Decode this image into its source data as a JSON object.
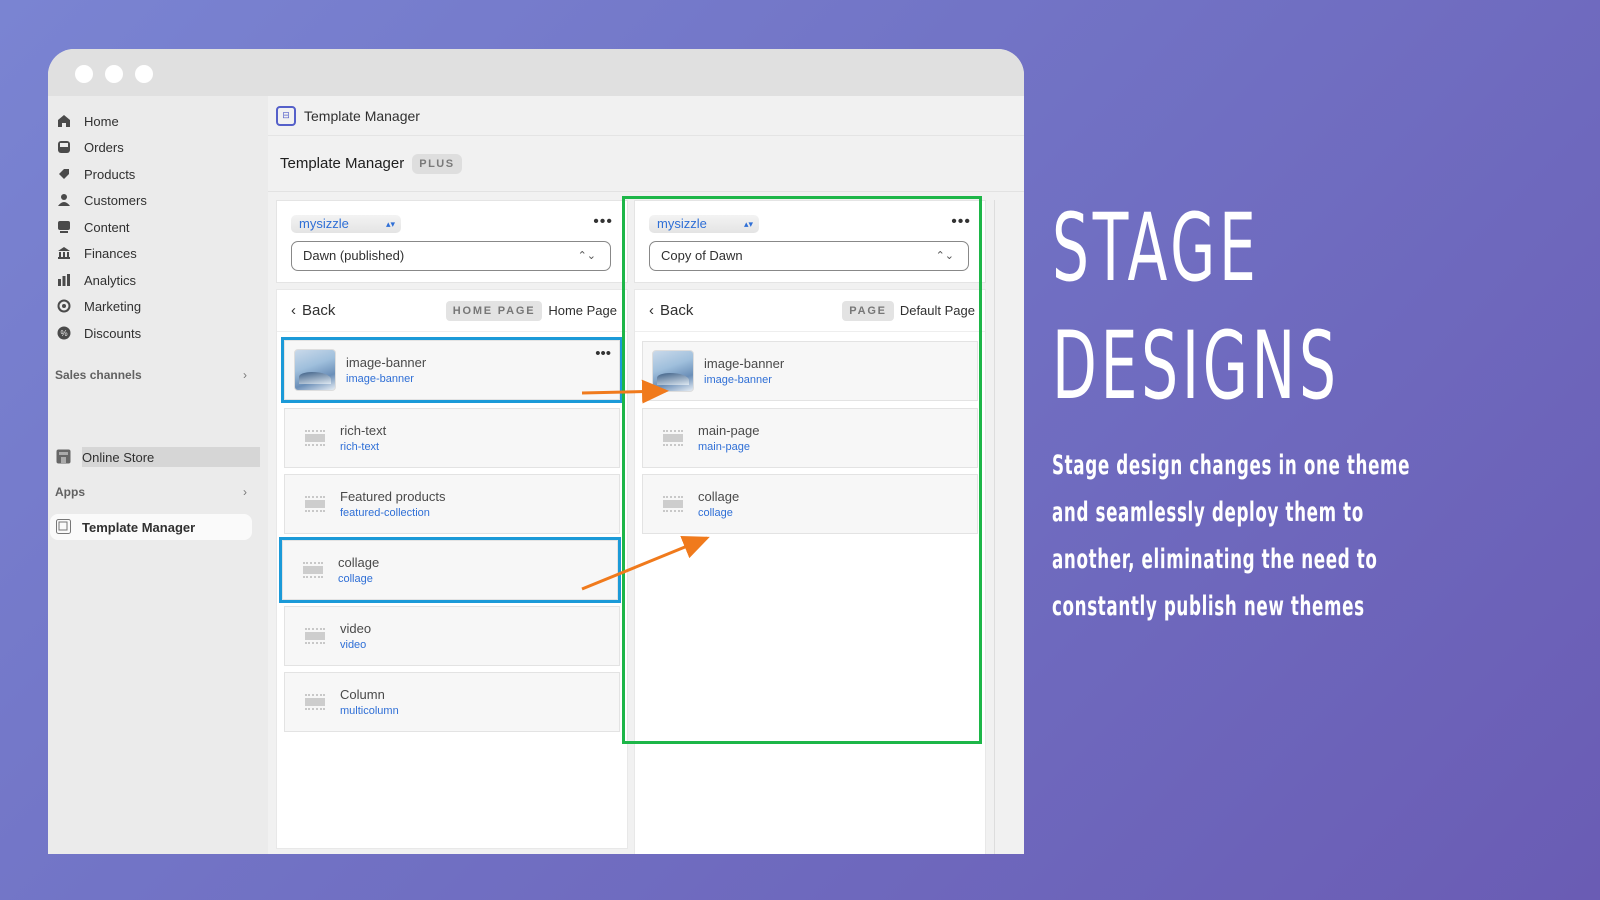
{
  "window": {
    "traffic_lights": [
      "close",
      "minimize",
      "maximize"
    ]
  },
  "sidebar": {
    "items": [
      {
        "label": "Home",
        "icon": "home-icon"
      },
      {
        "label": "Orders",
        "icon": "inbox-icon"
      },
      {
        "label": "Products",
        "icon": "tag-icon"
      },
      {
        "label": "Customers",
        "icon": "person-icon"
      },
      {
        "label": "Content",
        "icon": "image-icon"
      },
      {
        "label": "Finances",
        "icon": "bank-icon"
      },
      {
        "label": "Analytics",
        "icon": "bar-chart-icon"
      },
      {
        "label": "Marketing",
        "icon": "target-icon"
      },
      {
        "label": "Discounts",
        "icon": "discount-icon"
      }
    ],
    "sales_channels": {
      "heading": "Sales channels",
      "items": [
        {
          "label": "Online Store",
          "icon": "store-icon"
        }
      ]
    },
    "apps": {
      "heading": "Apps",
      "items": [
        {
          "label": "Template Manager",
          "icon": "template-icon"
        }
      ]
    }
  },
  "appbar": {
    "title": "Template Manager"
  },
  "page": {
    "title": "Template Manager",
    "badge": "PLUS"
  },
  "panels": [
    {
      "store": "mysizzle",
      "theme": "Dawn (published)",
      "back_label": "Back",
      "page_tag": "HOME PAGE",
      "page_name": "Home Page",
      "sections": [
        {
          "title": "image-banner",
          "type": "image-banner",
          "thumb": "image",
          "highlighted": true,
          "more": "..."
        },
        {
          "title": "rich-text",
          "type": "rich-text",
          "thumb": "placeholder",
          "highlighted": false
        },
        {
          "title": "Featured products",
          "type": "featured-collection",
          "thumb": "placeholder",
          "highlighted": false
        },
        {
          "title": "collage",
          "type": "collage",
          "thumb": "placeholder",
          "highlighted": true
        },
        {
          "title": "video",
          "type": "video",
          "thumb": "placeholder",
          "highlighted": false
        },
        {
          "title": "Column",
          "type": "multicolumn",
          "thumb": "placeholder",
          "highlighted": false
        }
      ]
    },
    {
      "store": "mysizzle",
      "theme": "Copy of Dawn",
      "back_label": "Back",
      "page_tag": "PAGE",
      "page_name": "Default Page",
      "sections": [
        {
          "title": "image-banner",
          "type": "image-banner",
          "thumb": "image"
        },
        {
          "title": "main-page",
          "type": "main-page",
          "thumb": "placeholder"
        },
        {
          "title": "collage",
          "type": "collage",
          "thumb": "placeholder"
        }
      ]
    }
  ],
  "more_label": "•••",
  "colors": {
    "highlight_source": "#1b9ad8",
    "highlight_target": "#1db648",
    "arrow": "#f07a1c",
    "link": "#2f6fd6"
  },
  "promo": {
    "headline_line1": "STAGE",
    "headline_line2": "DESIGNS",
    "body_lines": [
      "Stage design changes in one theme",
      "and seamlessly deploy them to",
      "another, eliminating the need to",
      "constantly publish new themes"
    ]
  }
}
